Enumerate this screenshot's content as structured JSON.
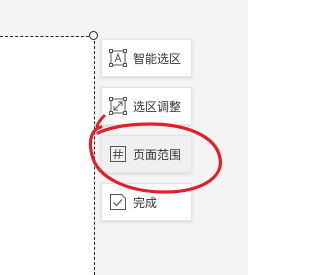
{
  "toolbar": {
    "items": [
      {
        "label": "智能选区",
        "icon": "smart-select-icon"
      },
      {
        "label": "选区调整",
        "icon": "resize-selection-icon"
      },
      {
        "label": "页面范围",
        "icon": "page-range-icon",
        "active": true
      },
      {
        "label": "完成",
        "icon": "checkmark-icon"
      }
    ]
  },
  "colors": {
    "annotation_stroke": "#e2202b",
    "button_bg": "#ffffff",
    "button_active_bg": "#f0f0f0",
    "icon_stroke": "#555555",
    "text": "#333333"
  }
}
